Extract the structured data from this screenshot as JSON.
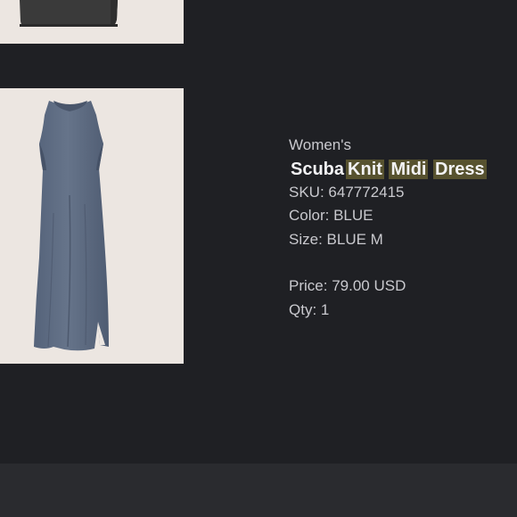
{
  "product": {
    "category": "Women's",
    "title_words": [
      {
        "text": "Scuba",
        "highlight": false
      },
      {
        "text": "Knit",
        "highlight": true
      },
      {
        "text": "Midi",
        "highlight": true
      },
      {
        "text": "Dress",
        "highlight": true
      }
    ],
    "sku": {
      "label": "SKU:",
      "value": "647772415"
    },
    "color": {
      "label": "Color:",
      "value": "BLUE"
    },
    "size": {
      "label": "Size:",
      "value": "BLUE M"
    },
    "price": {
      "label": "Price:",
      "value": "79.00 USD"
    },
    "qty": {
      "label": "Qty:",
      "value": "1"
    }
  },
  "colors": {
    "background": "#1f2024",
    "image_background": "#ece6e1",
    "dress_blue": "#5c6a7f",
    "top_garment": "#3a3a3a",
    "highlight": "#57522f",
    "bottom_bar": "#2a2b2f"
  }
}
